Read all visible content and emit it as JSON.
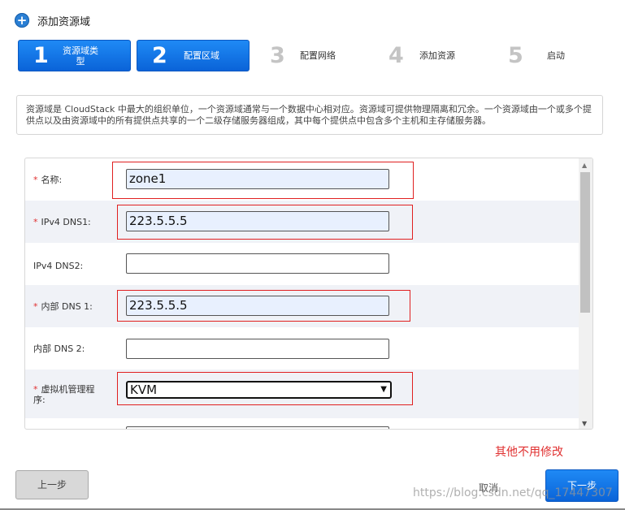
{
  "dialog": {
    "title": "添加资源域"
  },
  "steps": [
    {
      "num": "1",
      "label": "资源域类\n型"
    },
    {
      "num": "2",
      "label": "配置区域"
    },
    {
      "num": "3",
      "label": "配置网络"
    },
    {
      "num": "4",
      "label": "添加资源"
    },
    {
      "num": "5",
      "label": "启动"
    }
  ],
  "description": "资源域是 CloudStack 中最大的组织单位，一个资源域通常与一个数据中心相对应。资源域可提供物理隔离和冗余。一个资源域由一个或多个提供点以及由资源域中的所有提供点共享的一个二级存储服务器组成，其中每个提供点中包含多个主机和主存储服务器。",
  "form": {
    "required_mark": "*",
    "fields": [
      {
        "label": "名称:",
        "value": "zone1"
      },
      {
        "label": "IPv4 DNS1:",
        "value": "223.5.5.5"
      },
      {
        "label": "IPv4 DNS2:",
        "value": ""
      },
      {
        "label": "内部 DNS 1:",
        "value": "223.5.5.5"
      },
      {
        "label": "内部 DNS 2:",
        "value": ""
      },
      {
        "label": "虚拟机管理程\n序:",
        "value": "KVM"
      }
    ]
  },
  "annotation": "其他不用修改",
  "buttons": {
    "prev": "上一步",
    "cancel": "取消",
    "next": "下一步"
  },
  "watermark": "https://blog.csdn.net/qq_17447307",
  "colors": {
    "accent": "#0a63d8",
    "highlight": "#e02020",
    "required": "#e03030"
  }
}
